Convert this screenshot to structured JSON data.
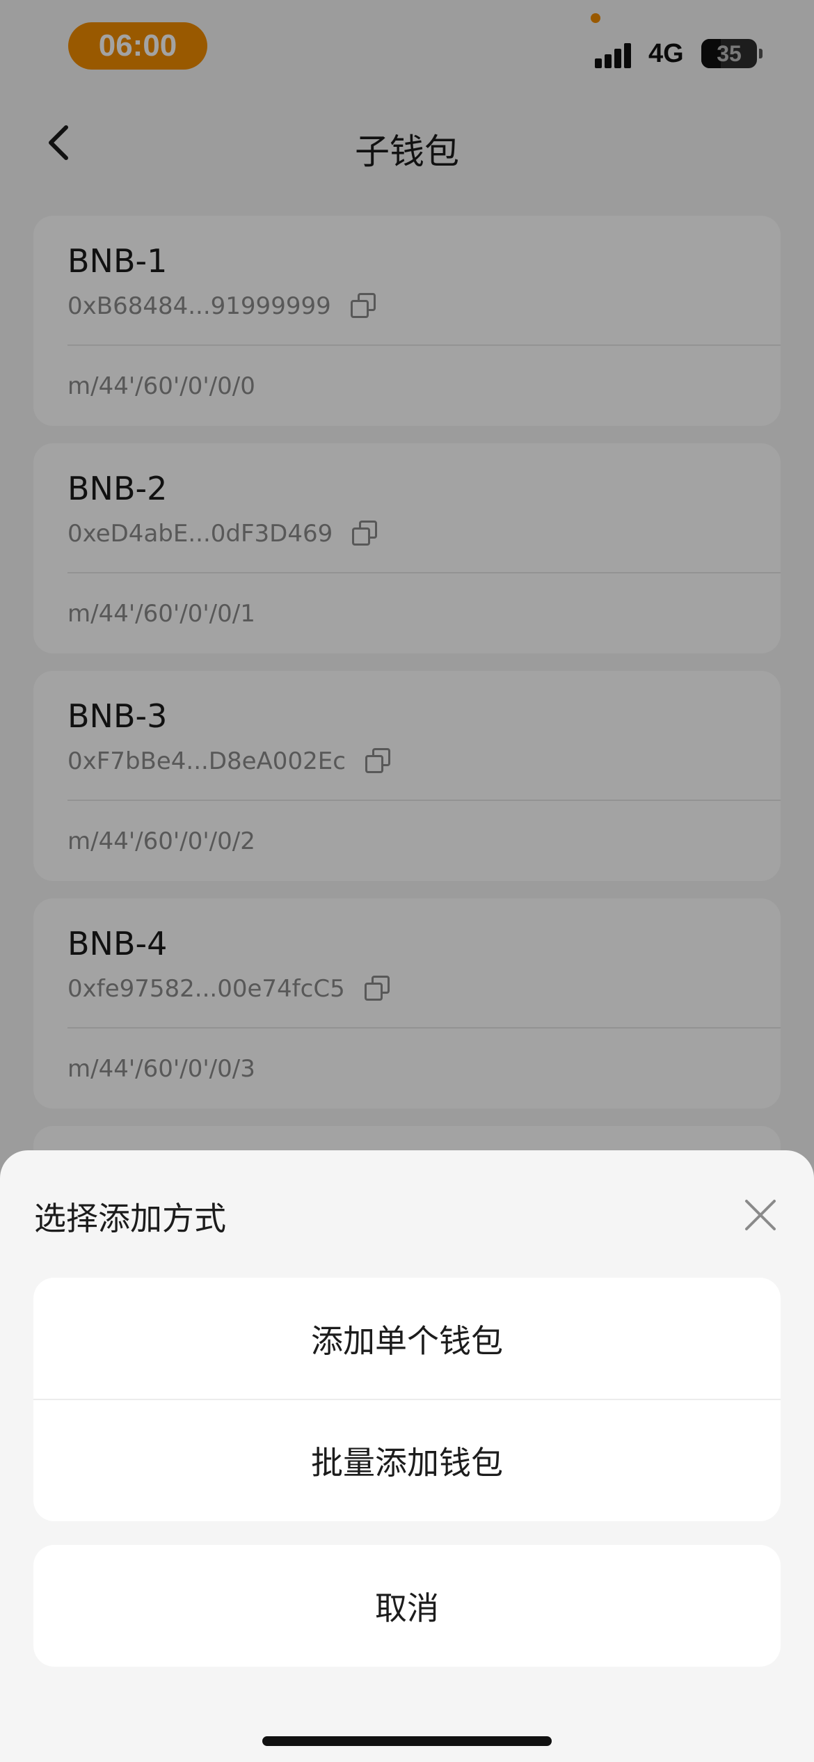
{
  "status_bar": {
    "time": "06:00",
    "network": "4G",
    "battery": "35",
    "accent_color": "#f08c00"
  },
  "nav": {
    "title": "子钱包",
    "back_icon": "chevron-left-icon"
  },
  "wallets": [
    {
      "name": "BNB-1",
      "address": "0xB68484...91999999",
      "path": "m/44'/60'/0'/0/0"
    },
    {
      "name": "BNB-2",
      "address": "0xeD4abE...0dF3D469",
      "path": "m/44'/60'/0'/0/1"
    },
    {
      "name": "BNB-3",
      "address": "0xF7bBe4...D8eA002Ec",
      "path": "m/44'/60'/0'/0/2"
    },
    {
      "name": "BNB-4",
      "address": "0xfe97582...00e74fcC5",
      "path": "m/44'/60'/0'/0/3"
    }
  ],
  "sheet": {
    "title": "选择添加方式",
    "close_icon": "close-icon",
    "options": [
      {
        "label": "添加单个钱包"
      },
      {
        "label": "批量添加钱包"
      }
    ],
    "cancel_label": "取消"
  }
}
